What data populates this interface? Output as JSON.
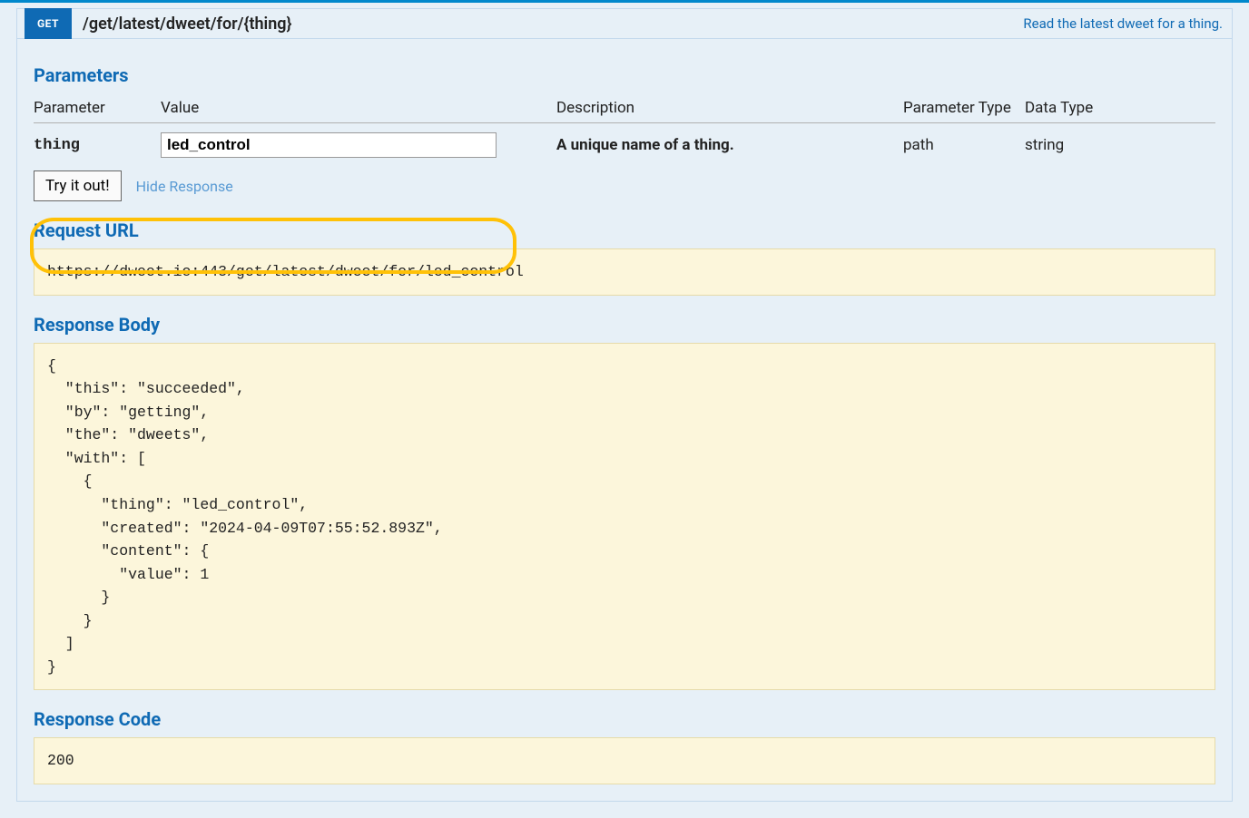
{
  "operation": {
    "method": "GET",
    "path": "/get/latest/dweet/for/{thing}",
    "summary": "Read the latest dweet for a thing."
  },
  "sections": {
    "parameters": "Parameters",
    "request_url": "Request URL",
    "response_body": "Response Body",
    "response_code": "Response Code"
  },
  "param_headers": {
    "parameter": "Parameter",
    "value": "Value",
    "description": "Description",
    "parameter_type": "Parameter Type",
    "data_type": "Data Type"
  },
  "params": [
    {
      "name": "thing",
      "value": "led_control",
      "description": "A unique name of a thing.",
      "ptype": "path",
      "dtype": "string"
    }
  ],
  "actions": {
    "try": "Try it out!",
    "hide": "Hide Response"
  },
  "request_url": "https://dweet.io:443/get/latest/dweet/for/led_control",
  "response_body": "{\n  \"this\": \"succeeded\",\n  \"by\": \"getting\",\n  \"the\": \"dweets\",\n  \"with\": [\n    {\n      \"thing\": \"led_control\",\n      \"created\": \"2024-04-09T07:55:52.893Z\",\n      \"content\": {\n        \"value\": 1\n      }\n    }\n  ]\n}",
  "response_code": "200"
}
